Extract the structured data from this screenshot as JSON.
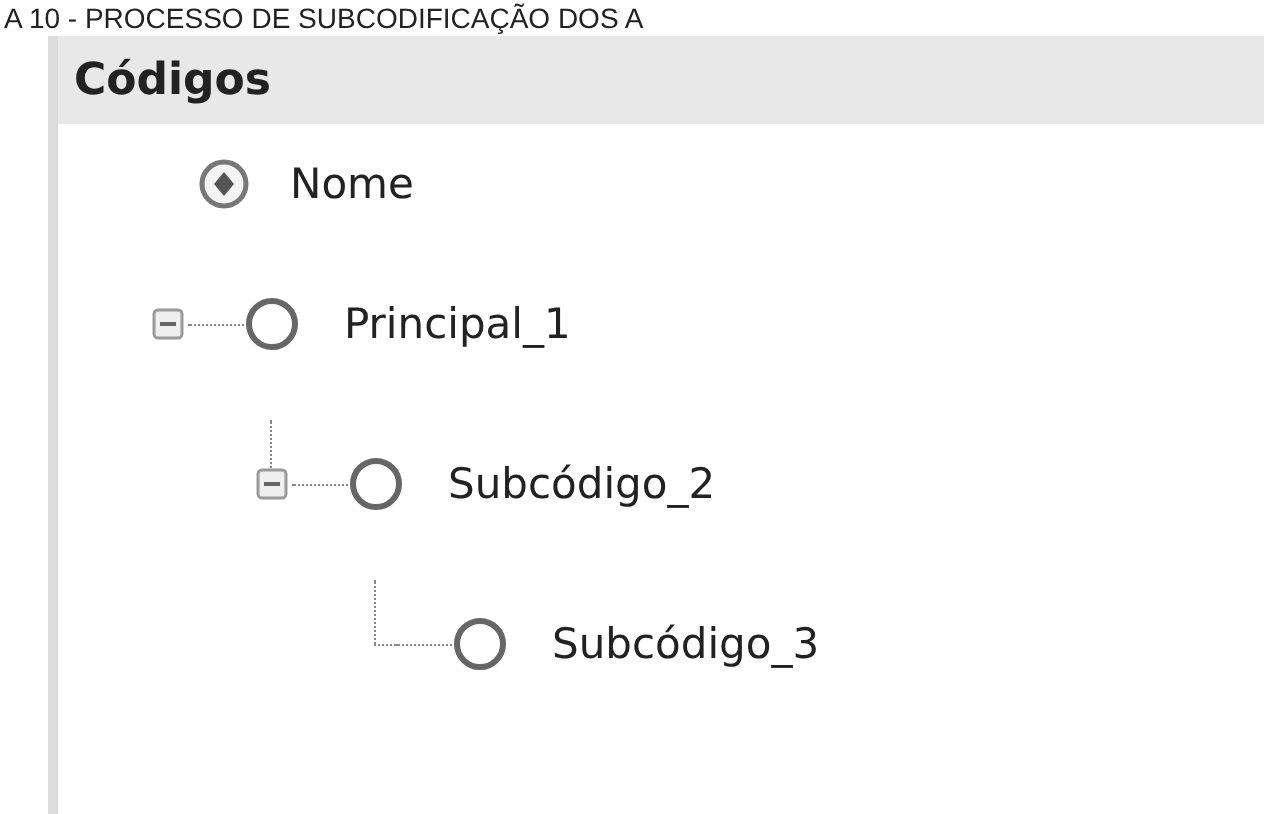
{
  "caption": "A 10 - PROCESSO DE SUBCODIFICAÇÃO DOS A",
  "panel": {
    "title": "Códigos",
    "column": {
      "label": "Nome"
    },
    "tree": [
      {
        "label": "Principal_1",
        "expanded": true,
        "children": [
          {
            "label": "Subcódigo_2",
            "expanded": true,
            "children": [
              {
                "label": "Subcódigo_3"
              }
            ]
          }
        ]
      }
    ]
  }
}
